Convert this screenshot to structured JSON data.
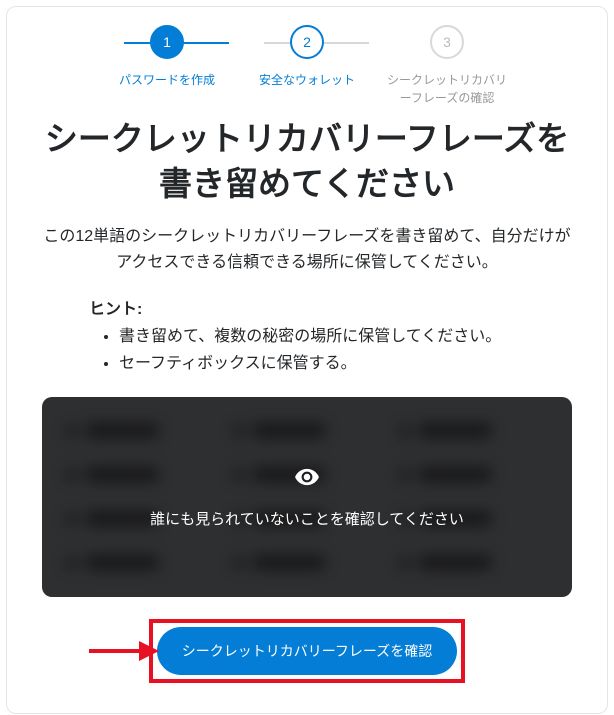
{
  "stepper": {
    "steps": [
      {
        "num": "1",
        "label": "パスワードを作成",
        "state": "active"
      },
      {
        "num": "2",
        "label": "安全なウォレット",
        "state": "current"
      },
      {
        "num": "3",
        "label": "シークレットリカバリーフレーズの確認",
        "state": "pending"
      }
    ]
  },
  "title": "シークレットリカバリーフレーズを書き留めてください",
  "description": "この12単語のシークレットリカバリーフレーズを書き留めて、自分だけがアクセスできる信頼できる場所に保管してください。",
  "hints": {
    "title": "ヒント:",
    "items": [
      "書き留めて、複数の秘密の場所に保管してください。",
      "セーフティボックスに保管する。"
    ]
  },
  "seed_phrase": {
    "reveal_prompt": "誰にも見られていないことを確認してください",
    "word_count": 12,
    "revealed": false
  },
  "confirm_button": "シークレットリカバリーフレーズを確認",
  "colors": {
    "primary": "#037dd6",
    "highlight_border": "#e81123",
    "seed_bg": "#2e2f31"
  }
}
